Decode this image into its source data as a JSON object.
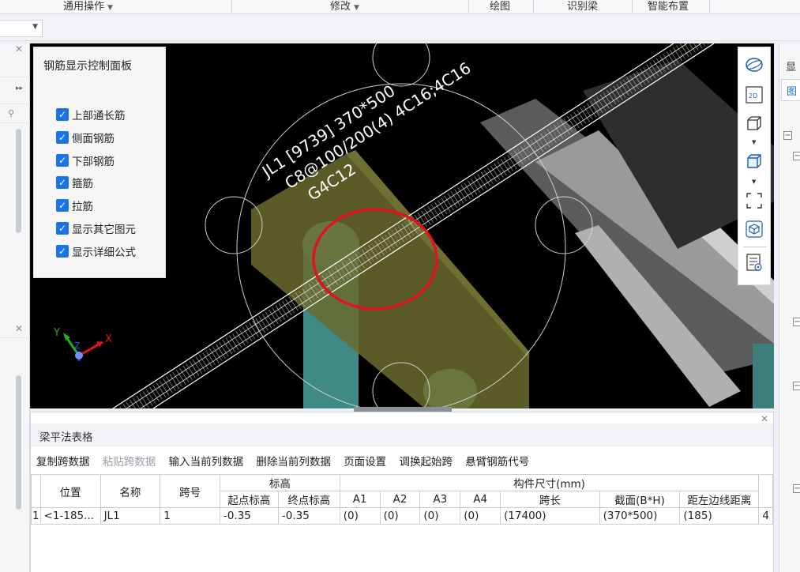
{
  "ribbon": {
    "groups": [
      {
        "label": "通用操作",
        "has_dropdown": true
      },
      {
        "label": "修改",
        "has_dropdown": true
      },
      {
        "label": "绘图"
      },
      {
        "label": "识别梁"
      },
      {
        "label": "智能布置"
      }
    ]
  },
  "control_panel": {
    "title": "钢筋显示控制面板",
    "options": [
      {
        "label": "上部通长筋",
        "checked": true
      },
      {
        "label": "侧面钢筋",
        "checked": true
      },
      {
        "label": "下部钢筋",
        "checked": true
      },
      {
        "label": "箍筋",
        "checked": true
      },
      {
        "label": "拉筋",
        "checked": true
      },
      {
        "label": "显示其它图元",
        "checked": true
      },
      {
        "label": "显示详细公式",
        "checked": true
      }
    ]
  },
  "viewport": {
    "beam_annotation": {
      "line1": "JL1 [9739] 370*500",
      "line2": "C8@100/200(4) 4C16;4C16",
      "line3": "G4C12"
    },
    "axis_labels": {
      "x": "X",
      "y": "Y",
      "z": "Z"
    },
    "highlight_color": "#e0141e",
    "rebar_color": "#d9d2c4",
    "column_color": "#4fa3a0",
    "beam_body_color": "#6b6b2e"
  },
  "view_toolbar": {
    "buttons": [
      "orbit-icon",
      "2d-view-icon",
      "3d-box-icon",
      "3d-solid-box-icon",
      "fit-region-icon",
      "iso-view-icon",
      "display-settings-icon"
    ],
    "label_2d": "2D"
  },
  "right_dock": {
    "tab1": "显",
    "tab2": "图"
  },
  "bottom_panel": {
    "title": "梁平法表格",
    "actions": [
      {
        "label": "复制跨数据",
        "enabled": true
      },
      {
        "label": "粘贴跨数据",
        "enabled": false
      },
      {
        "label": "输入当前列数据",
        "enabled": true
      },
      {
        "label": "删除当前列数据",
        "enabled": true
      },
      {
        "label": "页面设置",
        "enabled": true
      },
      {
        "label": "调换起始跨",
        "enabled": true
      },
      {
        "label": "悬臂钢筋代号",
        "enabled": true
      }
    ],
    "table": {
      "headers": {
        "position": "位置",
        "name": "名称",
        "span_no": "跨号",
        "elevation": "标高",
        "elev_start": "起点标高",
        "elev_end": "终点标高",
        "dimensions": "构件尺寸(mm)",
        "a1": "A1",
        "a2": "A2",
        "a3": "A3",
        "a4": "A4",
        "span_length": "跨长",
        "section": "截面(B*H)",
        "left_dist": "距左边线距离"
      },
      "rows": [
        {
          "index": "1",
          "position": "<1-185...",
          "name": "JL1",
          "span_no": "1",
          "elev_start": "-0.35",
          "elev_end": "-0.35",
          "a1": "(0)",
          "a2": "(0)",
          "a3": "(0)",
          "a4": "(0)",
          "span_length": "(17400)",
          "section": "(370*500)",
          "left_dist": "(185)",
          "overflow": "4"
        }
      ]
    }
  }
}
